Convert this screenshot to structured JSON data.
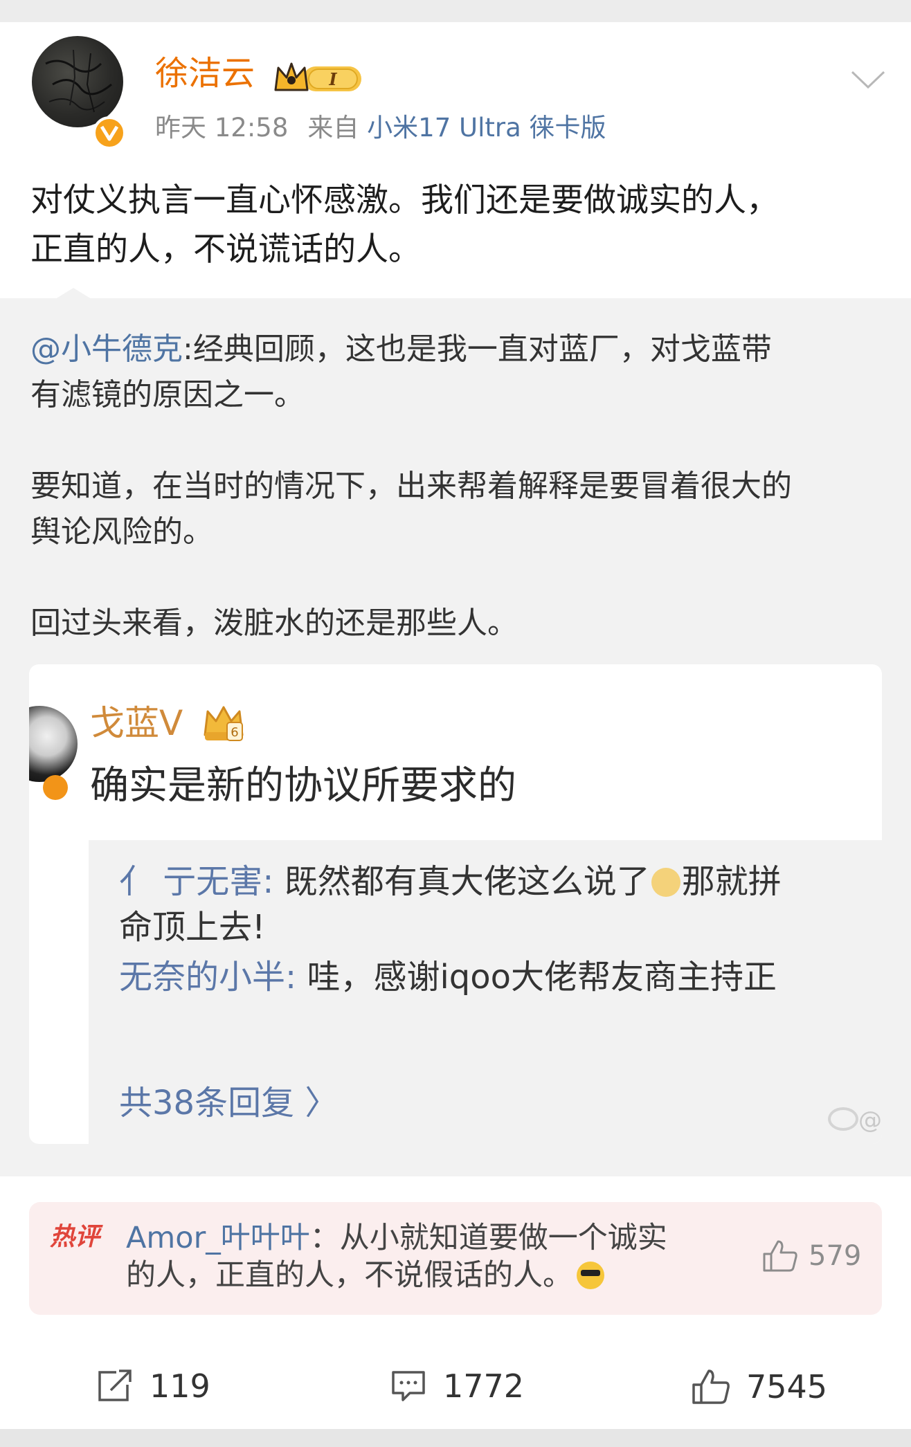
{
  "post": {
    "username": "徐洁云",
    "member_badge": "I",
    "time": "昨天 12:58",
    "source_prefix": "来自",
    "source": "小米17 Ultra 徕卡版",
    "text_line1": "对仗义执言一直心怀感激。我们还是要做诚实的人，",
    "text_line2": "正直的人，不说谎话的人。"
  },
  "repost": {
    "mention": "@小牛德克",
    "line1": ":经典回顾，这也是我一直对蓝厂，对戈蓝带",
    "line2": "有滤镜的原因之一。",
    "line3": "要知道，在当时的情况下，出来帮着解释是要冒着很大的",
    "line4": "舆论风险的。",
    "line5": "回过头来看，泼脏水的还是那些人。"
  },
  "embed": {
    "name": "戈蓝V",
    "text": "确实是新的协议所要求的",
    "reply1_name": "亻 亍无害:",
    "reply1_text": " 既然都有真大佬这么说了",
    "reply1_text2": "那就拼",
    "reply1_cont": "命顶上去!",
    "reply2_name": "无奈的小半:",
    "reply2_text": " 哇，感谢iqoo大佬帮友商主持正",
    "more": "共38条回复 〉",
    "watermark": "@"
  },
  "hot_comment": {
    "tag": "热评",
    "name": "Amor_叶叶叶",
    "text_part1": "：从小就知道要做一个诚实",
    "text_part2": "的人，正直的人，不说假话的人。",
    "likes": "579"
  },
  "actions": {
    "reposts": "119",
    "comments": "1772",
    "likes": "7545"
  },
  "colors": {
    "username": "#eb7100",
    "link": "#4f74a3",
    "hot_tag": "#e0453b",
    "badge_gold": "#f7a21b"
  },
  "icons": [
    "chevron-down-icon",
    "crown-icon",
    "verified-icon",
    "like-icon",
    "repost-icon",
    "comment-icon",
    "cool-emoji-icon",
    "doge-emoji-icon",
    "weibo-logo-icon"
  ]
}
